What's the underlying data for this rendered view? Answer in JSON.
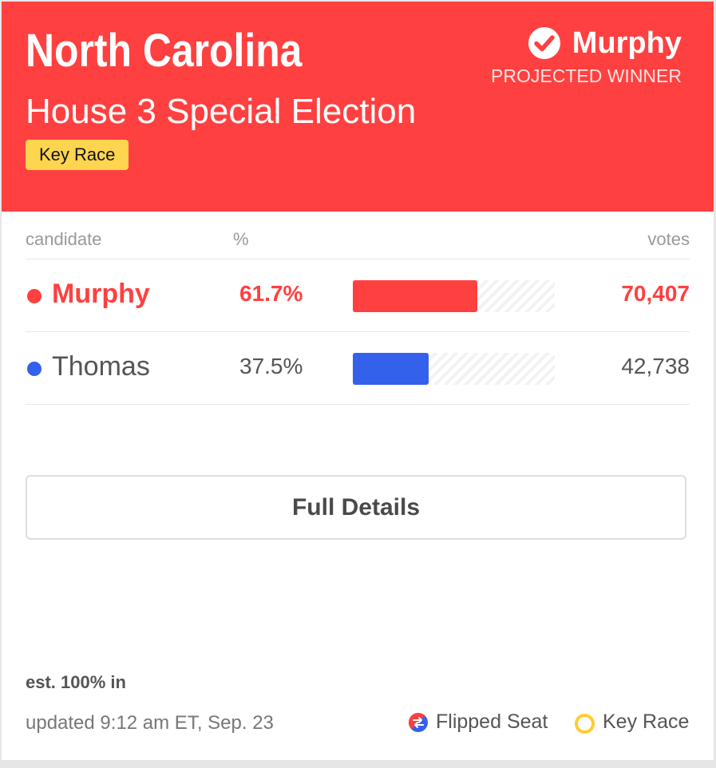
{
  "header": {
    "state": "North Carolina",
    "race": "House 3 Special Election",
    "tag": "Key Race",
    "winner_name": "Murphy",
    "winner_label": "PROJECTED WINNER"
  },
  "columns": {
    "candidate": "candidate",
    "pct": "%",
    "votes": "votes"
  },
  "candidates": [
    {
      "name": "Murphy",
      "pct": "61.7%",
      "votes": "70,407",
      "share": 0.617,
      "color": "#ff4040",
      "winner": true
    },
    {
      "name": "Thomas",
      "pct": "37.5%",
      "votes": "42,738",
      "share": 0.375,
      "color": "#3461eb",
      "winner": false
    }
  ],
  "button": {
    "label": "Full Details"
  },
  "footer": {
    "reporting": "est. 100% in",
    "updated": "updated 9:12 am ET, Sep. 23",
    "legend_flipped": "Flipped Seat",
    "legend_key": "Key Race"
  },
  "colors": {
    "republican": "#ff4040",
    "democrat": "#3461eb",
    "key_race": "#ffd54f"
  },
  "icons": {
    "winner": "check-circle-icon",
    "flipped": "flipped-seat-icon",
    "key_race": "key-race-ring-icon"
  }
}
